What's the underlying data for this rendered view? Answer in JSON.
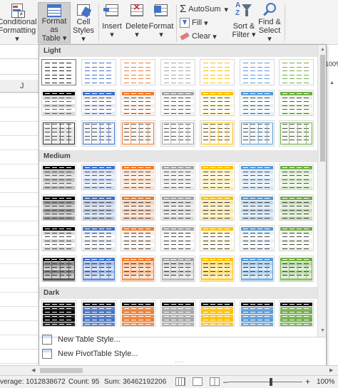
{
  "ribbon": {
    "conditional_formatting": {
      "line1": "Conditional",
      "line2": "Formatting ▾",
      "icon": "conditional-formatting-icon"
    },
    "format_as_table": {
      "line1": "Format as",
      "line2": "Table ▾",
      "icon": "table-icon"
    },
    "cell_styles": {
      "line1": "Cell",
      "line2": "Styles ▾",
      "icon": "cell-styles-icon"
    },
    "insert": {
      "label": "Insert",
      "caret": "▾",
      "icon": "insert-icon"
    },
    "delete": {
      "label": "Delete",
      "caret": "▾",
      "icon": "delete-icon"
    },
    "format": {
      "label": "Format",
      "caret": "▾",
      "icon": "format-icon"
    },
    "autosum": {
      "label": "AutoSum",
      "glyph": "Σ",
      "caret": "▾"
    },
    "fill": {
      "label": "Fill",
      "caret": "▾"
    },
    "clear": {
      "label": "Clear",
      "caret": "▾"
    },
    "sort_filter": {
      "line1": "Sort &",
      "line2": "Filter ▾",
      "icon": "sort-filter-icon"
    },
    "find_select": {
      "line1": "Find &",
      "line2": "Select ▾",
      "icon": "find-icon"
    }
  },
  "sheet": {
    "column_header": "J",
    "zoom_box": "100%"
  },
  "panel": {
    "sections": {
      "light": "Light",
      "medium": "Medium",
      "dark": "Dark"
    },
    "new_table_style": "New Table Style...",
    "new_pivot_style": "New PivotTable Style...",
    "grip": "....",
    "palette": {
      "black": "#000000",
      "blue": "#4472c4",
      "orange": "#ed7d31",
      "gray": "#a5a5a5",
      "gold": "#ffc000",
      "lightblue": "#5b9bd5",
      "green": "#70ad47"
    }
  },
  "statusbar": {
    "average": "verage: 1012838672",
    "count": "Count: 95",
    "sum": "Sum: 36462192206",
    "zoom": "100%",
    "minus": "–",
    "plus": "+"
  }
}
